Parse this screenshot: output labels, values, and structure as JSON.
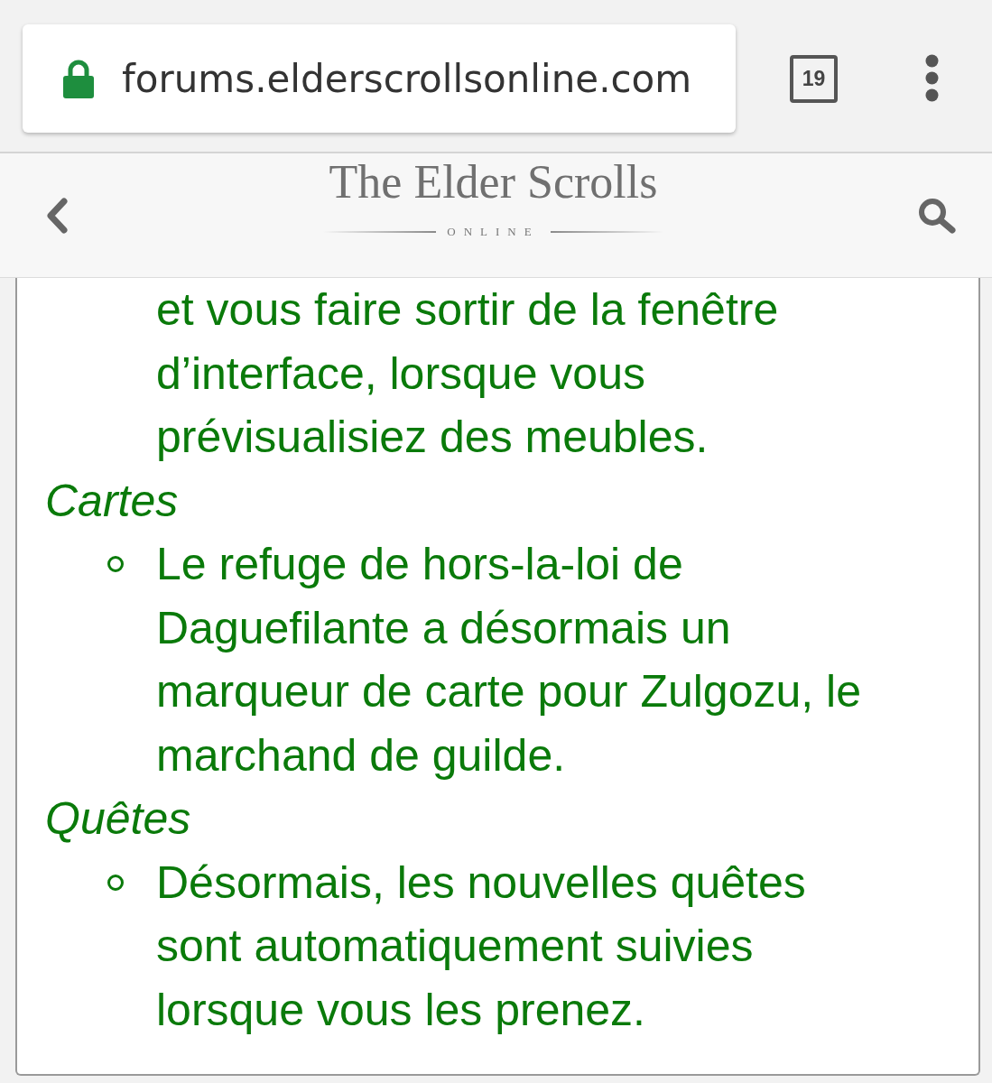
{
  "browser": {
    "url": "forums.elderscrollsonline.com",
    "tab_count": "19"
  },
  "site_header": {
    "logo_title": "The Elder Scrolls",
    "logo_subtitle": "ONLINE"
  },
  "content": [
    {
      "kind": "continued",
      "text": "et vous faire sortir de la fenêtre d’interface, lorsque vous prévisualisiez des meubles."
    },
    {
      "kind": "heading",
      "text": "Cartes"
    },
    {
      "kind": "item",
      "text": "Le refuge de hors-la-loi de Daguefilante a désormais un marqueur de carte pour Zulgozu, le marchand de guilde."
    },
    {
      "kind": "heading",
      "text": "Quêtes"
    },
    {
      "kind": "item",
      "text": "Désormais, les nouvelles quêtes sont automatiquement suivies lorsque vous les prenez."
    }
  ]
}
